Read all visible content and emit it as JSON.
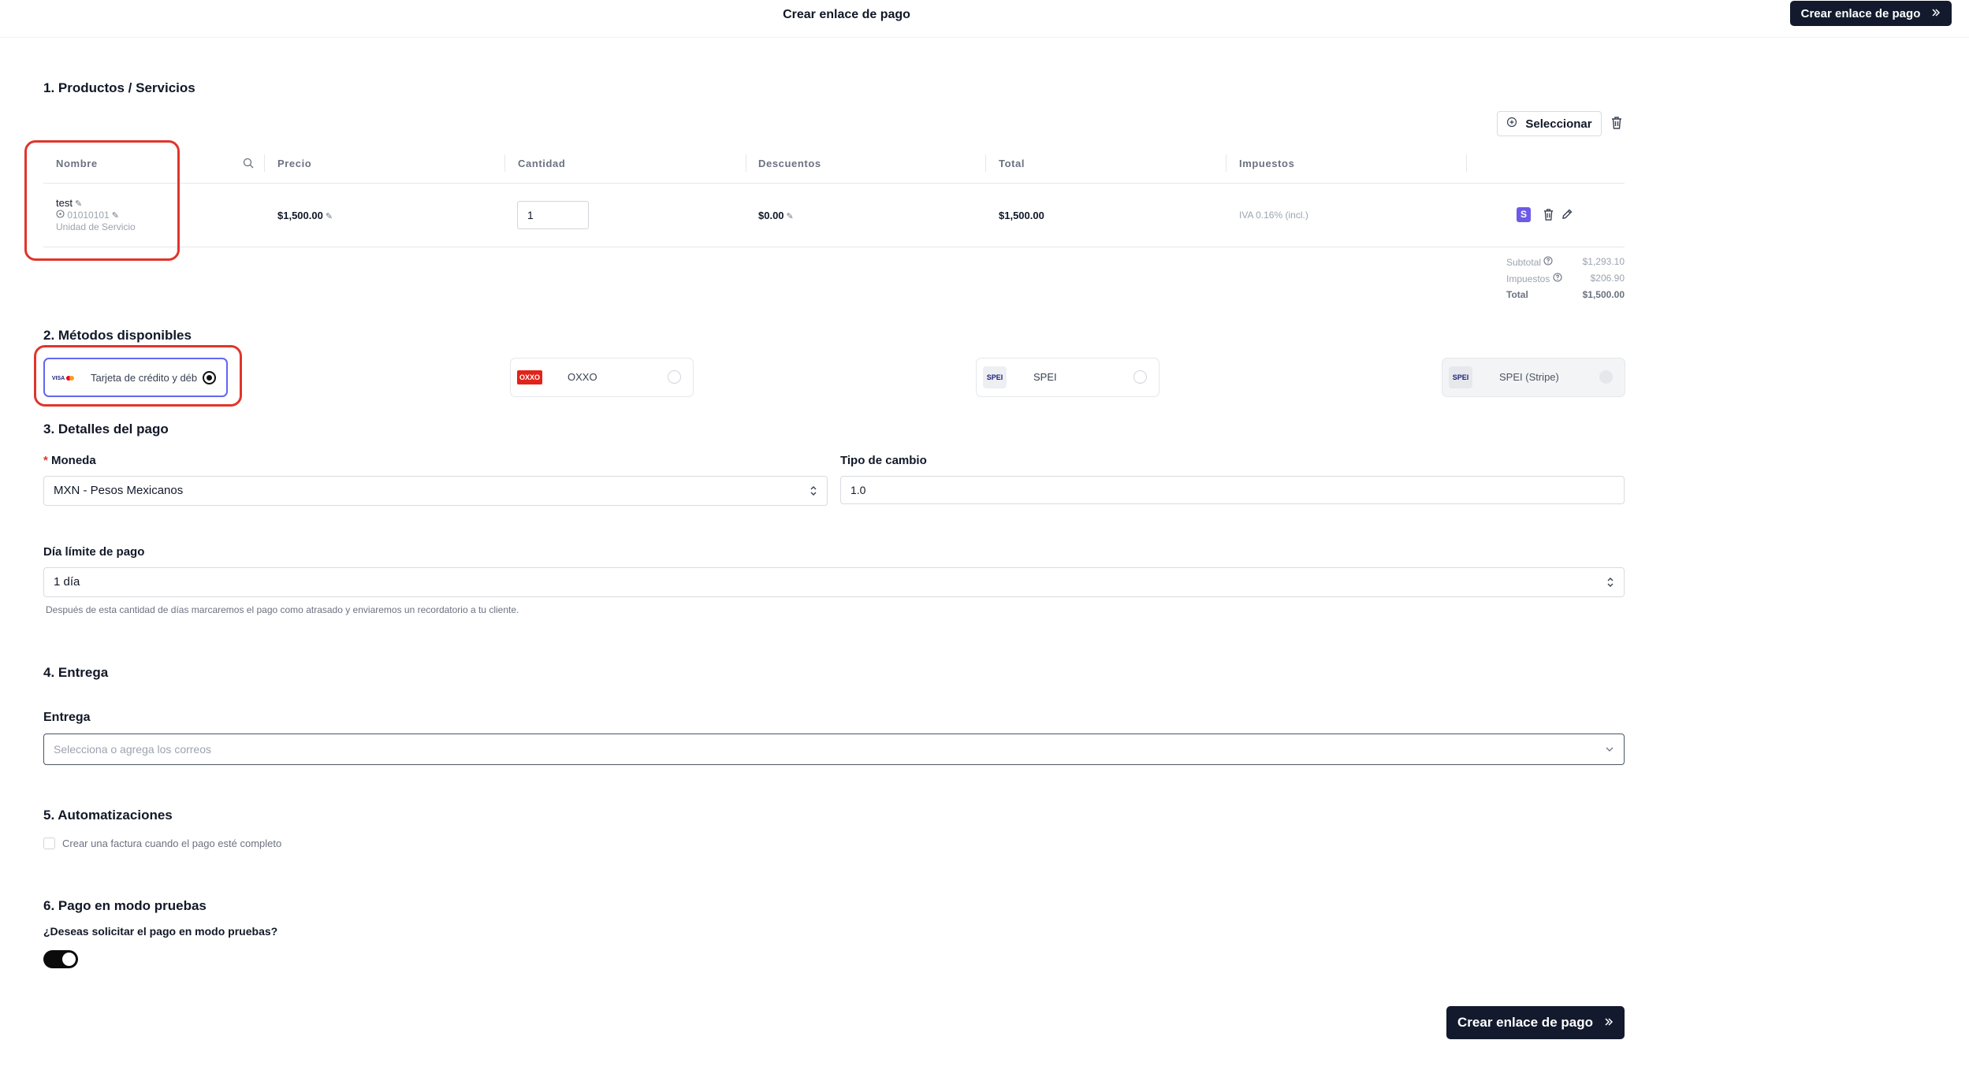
{
  "header": {
    "title": "Crear enlace de pago",
    "action_label": "Crear enlace de pago"
  },
  "products": {
    "section_title": "1. Productos / Servicios",
    "select_button": "Seleccionar",
    "columns": {
      "name": "Nombre",
      "price": "Precio",
      "quantity": "Cantidad",
      "discounts": "Descuentos",
      "total": "Total",
      "taxes": "Impuestos"
    },
    "row": {
      "name": "test",
      "code": "01010101",
      "unit": "Unidad de Servicio",
      "price": "$1,500.00",
      "quantity": "1",
      "discount": "$0.00",
      "total": "$1,500.00",
      "tax": "IVA 0.16% (incl.)",
      "badge": "S"
    },
    "summary": {
      "subtotal_label": "Subtotal",
      "subtotal_value": "$1,293.10",
      "taxes_label": "Impuestos",
      "taxes_value": "$206.90",
      "total_label": "Total",
      "total_value": "$1,500.00"
    }
  },
  "methods": {
    "section_title": "2. Métodos disponibles",
    "items": [
      {
        "label": "Tarjeta de crédito y déb",
        "logo": "VISA",
        "selected": true
      },
      {
        "label": "OXXO",
        "logo": "OXXO",
        "selected": false
      },
      {
        "label": "SPEI",
        "logo": "SPEI",
        "selected": false
      },
      {
        "label": "SPEI (Stripe)",
        "logo": "SPEI",
        "selected": false,
        "disabled": true
      }
    ]
  },
  "payment_details": {
    "section_title": "3. Detalles del pago",
    "required_mark": "*",
    "currency_label": "Moneda",
    "currency_value": "MXN - Pesos Mexicanos",
    "exchange_label": "Tipo de cambio",
    "exchange_value": "1.0",
    "due_label": "Día límite de pago",
    "due_value": "1 día",
    "due_help": "Después de esta cantidad de días marcaremos el pago como atrasado y enviaremos un recordatorio a tu cliente."
  },
  "delivery": {
    "section_title": "4. Entrega",
    "label": "Entrega",
    "placeholder": "Selecciona o agrega los correos"
  },
  "automations": {
    "section_title": "5. Automatizaciones",
    "invoice_checkbox": "Crear una factura cuando el pago esté completo"
  },
  "test_mode": {
    "section_title": "6. Pago en modo pruebas",
    "question": "¿Deseas solicitar el pago en modo pruebas?",
    "enabled": true
  },
  "footer": {
    "action_label": "Crear enlace de pago"
  },
  "colors": {
    "primary_dark": "#131a2e",
    "annotation_red": "#e0352b",
    "selected_border": "#6366f1",
    "badge_purple": "#6d5ae6"
  }
}
